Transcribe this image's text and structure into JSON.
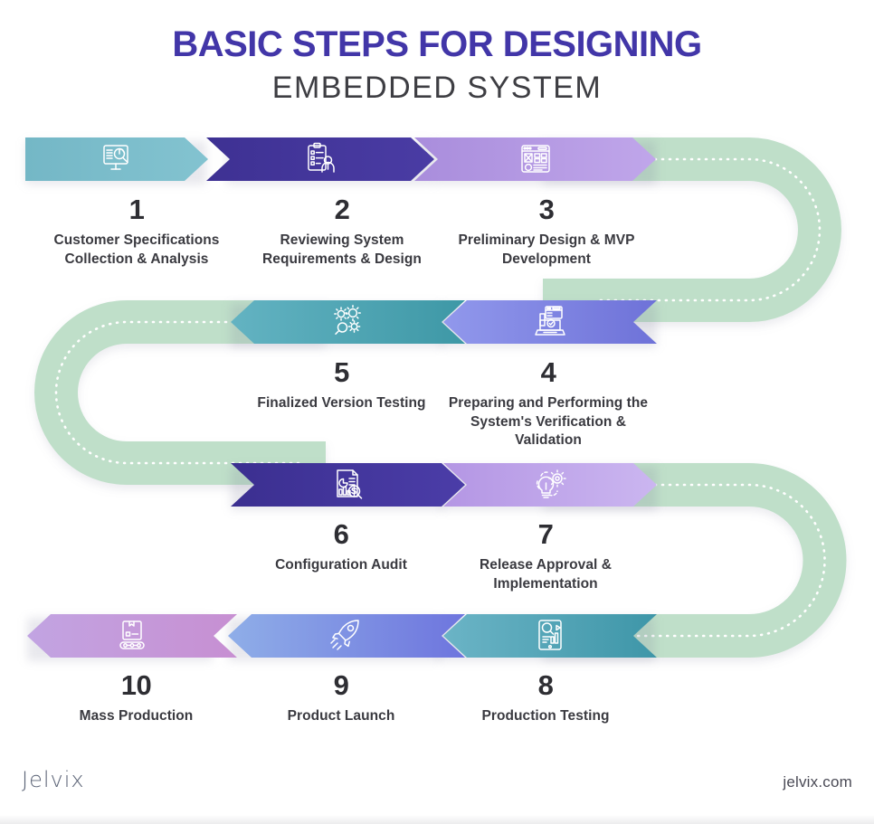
{
  "title": {
    "line1": "BASIC STEPS FOR DESIGNING",
    "line2": "EMBEDDED SYSTEM",
    "accent_color": "#4236A8",
    "sub_color": "#3E3E43"
  },
  "colors": {
    "track_green": "#BFDFC9",
    "dotted_line": "#FFFFFF",
    "number_text": "#2E2E33",
    "label_text": "#3A3A40",
    "background": "#FFFFFF"
  },
  "rows": [
    {
      "id": "row-1",
      "direction": "right",
      "steps": [
        "step-1",
        "step-2",
        "step-3"
      ]
    },
    {
      "id": "row-2",
      "direction": "left",
      "steps": [
        "step-5",
        "step-4"
      ]
    },
    {
      "id": "row-3",
      "direction": "right",
      "steps": [
        "step-6",
        "step-7"
      ]
    },
    {
      "id": "row-4",
      "direction": "left",
      "steps": [
        "step-10",
        "step-9",
        "step-8"
      ]
    }
  ],
  "steps": [
    {
      "number": "1",
      "label": "Customer Specifications Collection & Analysis",
      "icon": "monitor-chart-search-icon",
      "color_from": "#74B7C6",
      "color_to": "#7FC1CE"
    },
    {
      "number": "2",
      "label": "Reviewing System Requirements & Design",
      "icon": "clipboard-person-icon",
      "color_from": "#3E3193",
      "color_to": "#4A3CA4"
    },
    {
      "number": "3",
      "label": "Preliminary Design & MVP Development",
      "icon": "wireframe-layout-icon",
      "color_from": "#A98DDC",
      "color_to": "#C0A6EA"
    },
    {
      "number": "4",
      "label": "Preparing and Performing the System's Verification & Validation",
      "icon": "laptop-check-icon",
      "color_from": "#9198EC",
      "color_to": "#6E72D8"
    },
    {
      "number": "5",
      "label": "Finalized Version Testing",
      "icon": "gears-search-icon",
      "color_from": "#63B3C2",
      "color_to": "#3E98A6"
    },
    {
      "number": "6",
      "label": "Configuration Audit",
      "icon": "report-dollar-search-icon",
      "color_from": "#3B2F90",
      "color_to": "#4B3DA8"
    },
    {
      "number": "7",
      "label": "Release Approval & Implementation",
      "icon": "lightbulb-gear-icon",
      "color_from": "#B496E4",
      "color_to": "#C9B3EF"
    },
    {
      "number": "8",
      "label": "Production Testing",
      "icon": "tablet-analytics-icon",
      "color_from": "#6BB4C6",
      "color_to": "#3E96A8"
    },
    {
      "number": "9",
      "label": "Product Launch",
      "icon": "rocket-icon",
      "color_from": "#8FAEE8",
      "color_to": "#6E75DE"
    },
    {
      "number": "10",
      "label": "Mass Production",
      "icon": "box-conveyor-icon",
      "color_from": "#C2A4E2",
      "color_to": "#C78FD2"
    }
  ],
  "footer": {
    "logo": "Jelvix",
    "url": "jelvix.com"
  }
}
